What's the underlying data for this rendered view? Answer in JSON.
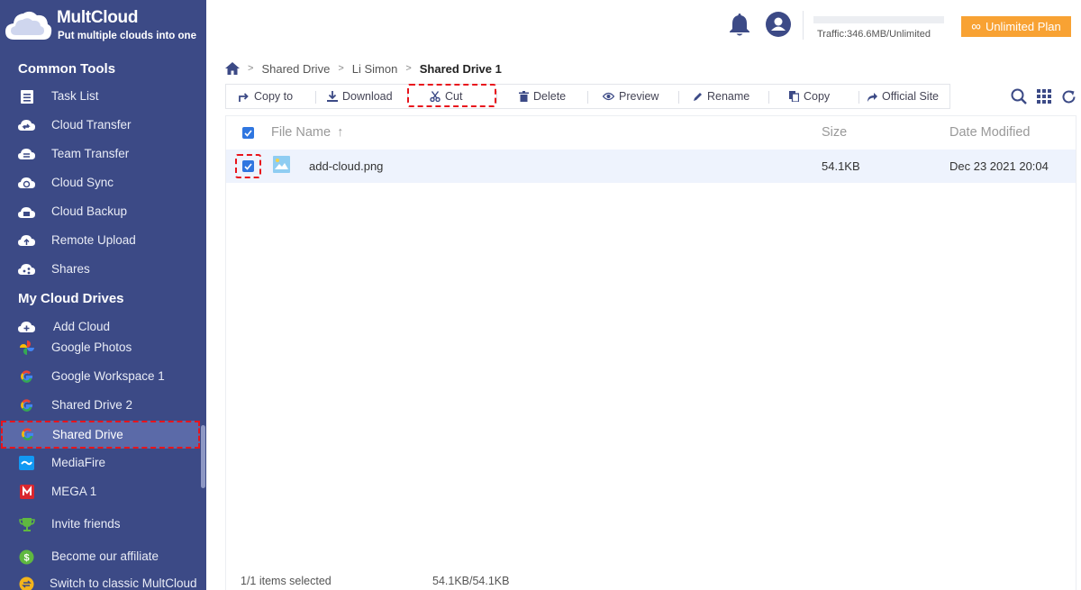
{
  "app": {
    "name": "MultCloud",
    "tagline": "Put multiple clouds into one"
  },
  "sidebar": {
    "common_tools_title": "Common Tools",
    "tools": [
      {
        "label": "Task List",
        "icon": "task-list-icon"
      },
      {
        "label": "Cloud Transfer",
        "icon": "cloud-transfer-icon"
      },
      {
        "label": "Team Transfer",
        "icon": "team-transfer-icon"
      },
      {
        "label": "Cloud Sync",
        "icon": "cloud-sync-icon"
      },
      {
        "label": "Cloud Backup",
        "icon": "cloud-backup-icon"
      },
      {
        "label": "Remote Upload",
        "icon": "remote-upload-icon"
      },
      {
        "label": "Shares",
        "icon": "shares-icon"
      }
    ],
    "my_drives_title": "My Cloud Drives",
    "drives": [
      {
        "label": "Add Cloud",
        "icon": "add-cloud-icon"
      },
      {
        "label": "Google Photos",
        "icon": "google-photos-icon"
      },
      {
        "label": "Google Workspace 1",
        "icon": "google-icon"
      },
      {
        "label": "Shared Drive 2",
        "icon": "google-icon"
      },
      {
        "label": "Shared Drive",
        "icon": "google-icon"
      },
      {
        "label": "MediaFire",
        "icon": "mediafire-icon"
      },
      {
        "label": "MEGA 1",
        "icon": "mega-icon"
      }
    ],
    "extras": [
      {
        "label": "Invite friends",
        "icon": "trophy-icon"
      },
      {
        "label": "Become our affiliate",
        "icon": "dollar-icon"
      },
      {
        "label": "Switch to classic MultCloud",
        "icon": "switch-icon"
      }
    ]
  },
  "header": {
    "traffic": "Traffic:346.6MB/Unlimited",
    "plan_label": "Unlimited Plan"
  },
  "breadcrumb": [
    "Shared Drive",
    "Li Simon",
    "Shared Drive 1"
  ],
  "toolbar": {
    "copy_to": "Copy to",
    "download": "Download",
    "cut": "Cut",
    "delete": "Delete",
    "preview": "Preview",
    "rename": "Rename",
    "copy": "Copy",
    "official_site": "Official Site"
  },
  "table": {
    "columns": {
      "name": "File Name",
      "size": "Size",
      "date": "Date Modified"
    },
    "rows": [
      {
        "name": "add-cloud.png",
        "size": "54.1KB",
        "date": "Dec 23 2021 20:04",
        "selected": true
      }
    ]
  },
  "footer": {
    "selection": "1/1 items selected",
    "size": "54.1KB/54.1KB"
  },
  "colors": {
    "sidebar": "#3c4a86",
    "accent": "#2f76e0",
    "plan": "#f8a233",
    "highlight": "#e8141c"
  }
}
